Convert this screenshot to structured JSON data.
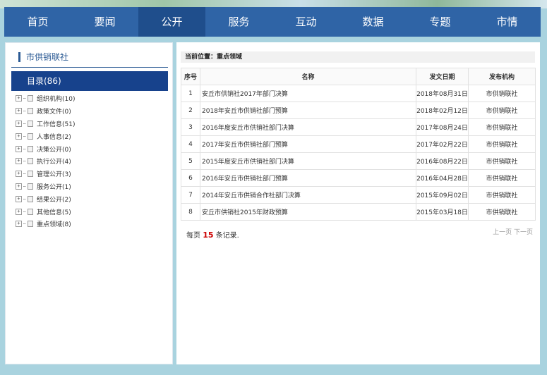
{
  "nav": {
    "items": [
      {
        "label": "首页"
      },
      {
        "label": "要闻"
      },
      {
        "label": "公开"
      },
      {
        "label": "服务"
      },
      {
        "label": "互动"
      },
      {
        "label": "数据"
      },
      {
        "label": "专题"
      },
      {
        "label": "市情"
      }
    ],
    "active_index": 2
  },
  "sidebar": {
    "title": "市供销联社",
    "catalog_label": "目录(86)",
    "tree": [
      {
        "label": "组织机构(10)"
      },
      {
        "label": "政策文件(0)"
      },
      {
        "label": "工作信息(51)"
      },
      {
        "label": "人事信息(2)"
      },
      {
        "label": "决策公开(0)"
      },
      {
        "label": "执行公开(4)"
      },
      {
        "label": "管理公开(3)"
      },
      {
        "label": "服务公开(1)"
      },
      {
        "label": "结果公开(2)"
      },
      {
        "label": "其他信息(5)"
      },
      {
        "label": "重点领域(8)"
      }
    ]
  },
  "main": {
    "breadcrumb": "当前位置：重点领域",
    "table": {
      "headers": {
        "no": "序号",
        "name": "名称",
        "date": "发文日期",
        "org": "发布机构"
      },
      "rows": [
        {
          "no": "1",
          "name": "安丘市供销社2017年部门决算",
          "date": "2018年08月31日",
          "org": "市供销联社"
        },
        {
          "no": "2",
          "name": "2018年安丘市供销社部门预算",
          "date": "2018年02月12日",
          "org": "市供销联社"
        },
        {
          "no": "3",
          "name": "2016年度安丘市供销社部门决算",
          "date": "2017年08月24日",
          "org": "市供销联社"
        },
        {
          "no": "4",
          "name": "2017年安丘市供销社部门预算",
          "date": "2017年02月22日",
          "org": "市供销联社"
        },
        {
          "no": "5",
          "name": "2015年度安丘市供销社部门决算",
          "date": "2016年08月22日",
          "org": "市供销联社"
        },
        {
          "no": "6",
          "name": "2016年安丘市供销社部门预算",
          "date": "2016年04月28日",
          "org": "市供销联社"
        },
        {
          "no": "7",
          "name": "2014年安丘市供销合作社部门决算",
          "date": "2015年09月02日",
          "org": "市供销联社"
        },
        {
          "no": "8",
          "name": "安丘市供销社2015年财政预算",
          "date": "2015年03月18日",
          "org": "市供销联社"
        }
      ]
    },
    "per_page": {
      "prefix": "每页",
      "count": "15",
      "suffix": "条记录."
    },
    "pager": {
      "prev": "上一页",
      "next": "下一页"
    }
  },
  "colors": {
    "nav_bg": "#2f64a6",
    "nav_active": "#1f4e8c",
    "catalog_head": "#17428c",
    "page_bg": "#a9d3df",
    "highlight_red": "#cc0000"
  }
}
